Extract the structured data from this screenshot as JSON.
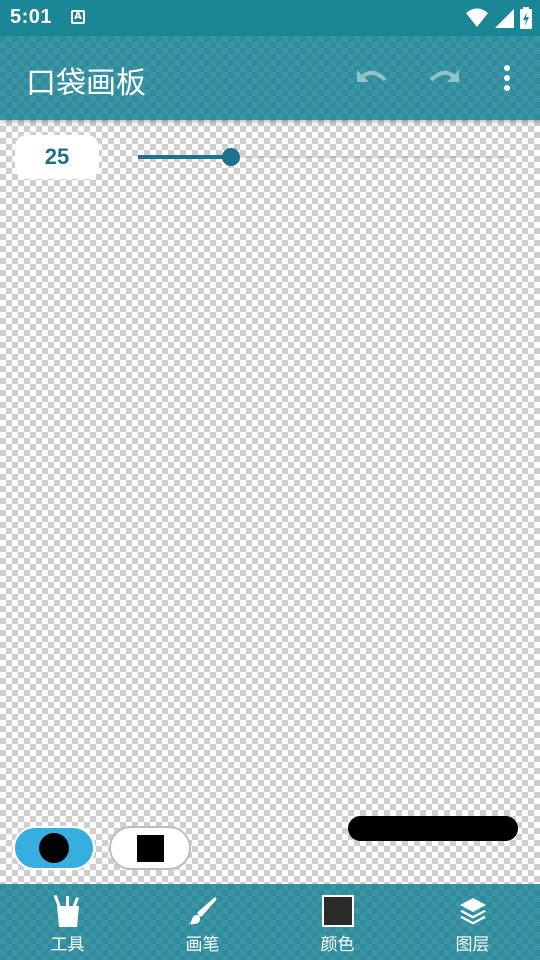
{
  "status_bar": {
    "time": "5:01",
    "notification_letter": "A"
  },
  "app_bar": {
    "title": "口袋画板",
    "undo_icon": "undo-icon",
    "redo_icon": "redo-icon",
    "more_icon": "more-vert-icon"
  },
  "brush": {
    "size": "25",
    "slider_fraction": 0.25,
    "shapes": [
      {
        "name": "round",
        "selected": true
      },
      {
        "name": "square",
        "selected": false
      }
    ],
    "color": "#000000"
  },
  "colors": {
    "accent": "#2e8c9c",
    "status_bar": "#1b8696",
    "slider": "#1f7190",
    "selected_shape": "#36aee0",
    "current_color": "#2a2a2a"
  },
  "bottom_nav": [
    {
      "label": "工具",
      "icon": "tools-icon"
    },
    {
      "label": "画笔",
      "icon": "brush-icon"
    },
    {
      "label": "颜色",
      "icon": "color-swatch-icon"
    },
    {
      "label": "图层",
      "icon": "layers-icon"
    }
  ]
}
